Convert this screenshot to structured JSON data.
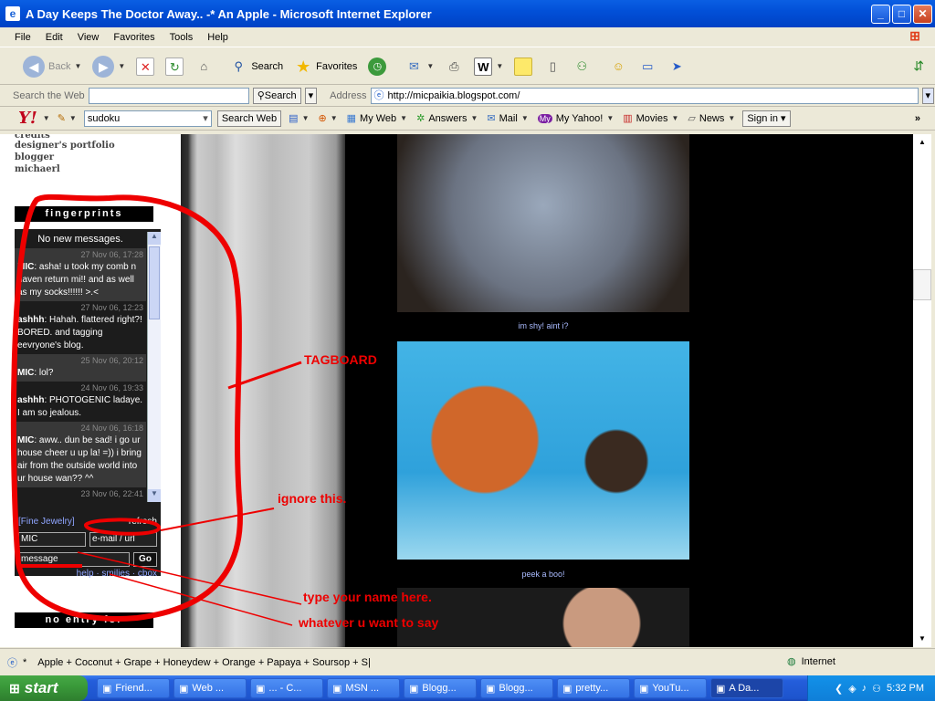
{
  "window": {
    "title": "A Day Keeps The Doctor Away.. -* An Apple - Microsoft Internet Explorer"
  },
  "menu": [
    "File",
    "Edit",
    "View",
    "Favorites",
    "Tools",
    "Help"
  ],
  "toolbar": {
    "back": "Back",
    "search": "Search",
    "favorites": "Favorites"
  },
  "searchbar": {
    "label": "Search the Web",
    "search_btn": "Search",
    "address_label": "Address",
    "url": "http://micpaikia.blogspot.com/"
  },
  "yahoo": {
    "query": "sudoku",
    "search_web": "Search Web",
    "my_web": "My Web",
    "answers": "Answers",
    "mail": "Mail",
    "my_yahoo": "My Yahoo!",
    "movies": "Movies",
    "news": "News",
    "sign_in": "Sign in"
  },
  "sidebar": {
    "links": [
      "credits",
      "designer's portfolio",
      "blogger",
      "michaerl"
    ],
    "fingerprints": "fingerprints",
    "no_entry": "no entry for",
    "cbox": {
      "no_new": "No new messages.",
      "messages": [
        {
          "when": "27 Nov 06, 17:28",
          "who": "MIC",
          "text": ": asha! u took my comb n haven return mi!! and as well as my socks!!!!!! >.<"
        },
        {
          "when": "27 Nov 06, 12:23",
          "who": "ashhh",
          "text": ": Hahah. flattered right?! BORED. and tagging eevryone's blog."
        },
        {
          "when": "25 Nov 06, 20:12",
          "who": "MIC",
          "text": ": lol?"
        },
        {
          "when": "24 Nov 06, 19:33",
          "who": "ashhh",
          "text": ": PHOTOGENIC ladaye. I am so jealous."
        },
        {
          "when": "24 Nov 06, 16:18",
          "who": "MIC",
          "text": ": aww.. dun be sad! i go ur house cheer u up la! =)) i bring air from the outside world into ur house wan?? ^^"
        },
        {
          "when": "23 Nov 06, 22:41",
          "who": "",
          "text": ""
        }
      ],
      "ad": "[Fine Jewelry]",
      "refresh": "refresh",
      "name_value": "MIC",
      "email_value": "e-mail / url",
      "message_value": "message",
      "go": "Go",
      "footer": "help · smilies · cbox"
    }
  },
  "posts": [
    {
      "caption": "im shy! aint i?"
    },
    {
      "caption": "peek a boo!"
    }
  ],
  "annotations": {
    "tagboard": "TAGBOARD",
    "ignore": "ignore this.",
    "name": "type your name here.",
    "say": "whatever u want to say"
  },
  "status": {
    "text": "Apple + Coconut + Grape + Honeydew + Orange + Papaya + Soursop + S|",
    "zone": "Internet"
  },
  "taskbar": {
    "start": "start",
    "tasks": [
      "Friend...",
      "Web ...",
      "... - C...",
      "MSN ...",
      "Blogg...",
      "Blogg...",
      "pretty...",
      "YouTu...",
      "A Da..."
    ],
    "clock": "5:32 PM"
  },
  "colors": {
    "accent_red": "#e00000",
    "caption_blue": "#aabbff"
  }
}
